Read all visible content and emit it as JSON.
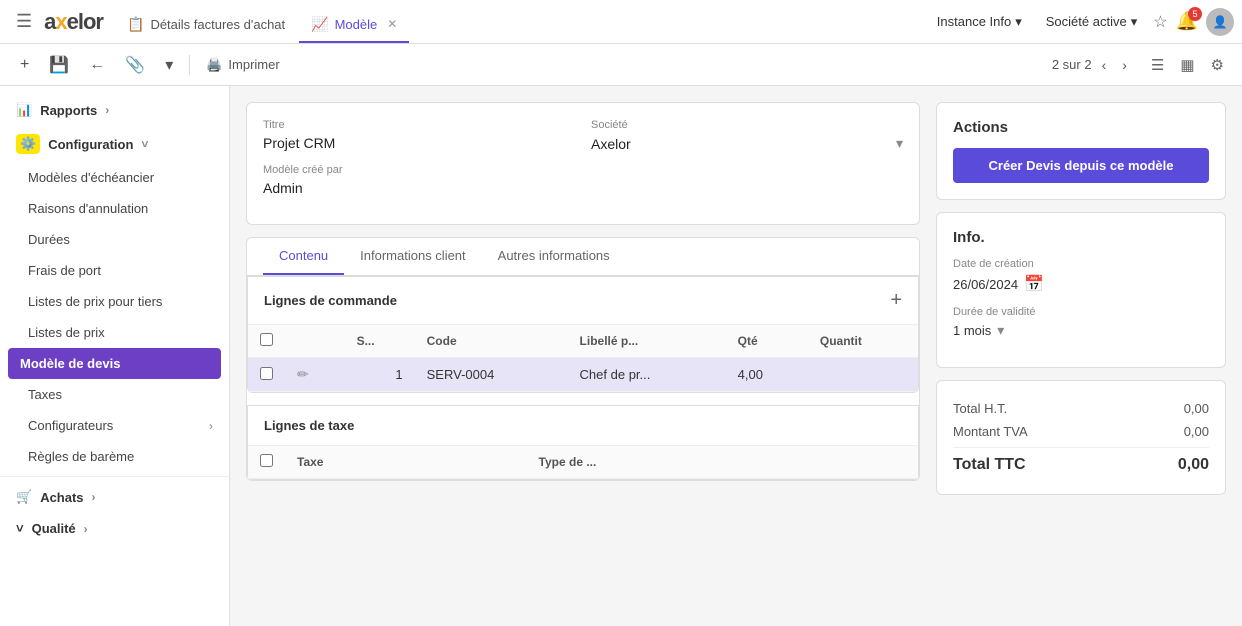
{
  "topbar": {
    "brand": "axelor",
    "tabs": [
      {
        "id": "factures",
        "label": "Détails factures d'achat",
        "icon": "📋",
        "active": false,
        "closable": false
      },
      {
        "id": "modele",
        "label": "Modèle",
        "icon": "📈",
        "active": true,
        "closable": true
      }
    ],
    "instance_info": "Instance Info",
    "societe_active": "Société active",
    "notification_count": "5"
  },
  "actionbar": {
    "add_icon": "+",
    "save_icon": "💾",
    "back_icon": "←",
    "attach_icon": "📎",
    "arrow_icon": "▾",
    "print_label": "Imprimer",
    "pagination": "2 sur 2"
  },
  "sidebar": {
    "sections": [
      {
        "id": "rapports",
        "label": "Rapports",
        "icon": "📊",
        "has_children": true
      },
      {
        "id": "configuration",
        "label": "Configuration",
        "icon": "⚙️",
        "has_children": true,
        "expanded": true
      }
    ],
    "config_items": [
      {
        "id": "modeles-echeancier",
        "label": "Modèles d'échéancier"
      },
      {
        "id": "raisons-annulation",
        "label": "Raisons d'annulation"
      },
      {
        "id": "durees",
        "label": "Durées"
      },
      {
        "id": "frais-port",
        "label": "Frais de port"
      },
      {
        "id": "listes-prix-tiers",
        "label": "Listes de prix pour tiers"
      },
      {
        "id": "listes-prix",
        "label": "Listes de prix"
      },
      {
        "id": "modele-devis",
        "label": "Modèle de devis",
        "active": true
      }
    ],
    "other_sections": [
      {
        "id": "taxes",
        "label": "Taxes"
      },
      {
        "id": "configurateurs",
        "label": "Configurateurs",
        "has_children": true
      },
      {
        "id": "regles-bareme",
        "label": "Règles de barème"
      },
      {
        "id": "achats",
        "label": "Achats",
        "icon": "🛒",
        "has_children": true
      },
      {
        "id": "qualite",
        "label": "Qualité",
        "has_children": true
      }
    ]
  },
  "form": {
    "title_label": "Titre",
    "title_value": "Projet CRM",
    "societe_label": "Société",
    "societe_value": "Axelor",
    "modele_cree_par_label": "Modèle créé par",
    "modele_cree_par_value": "Admin",
    "tabs": [
      {
        "id": "contenu",
        "label": "Contenu",
        "active": true
      },
      {
        "id": "informations-client",
        "label": "Informations client",
        "active": false
      },
      {
        "id": "autres-informations",
        "label": "Autres informations",
        "active": false
      }
    ],
    "lignes_commande": {
      "title": "Lignes de commande",
      "columns": [
        "",
        "S...",
        "Code",
        "Libellé p...",
        "Qté",
        "Quantit"
      ],
      "rows": [
        {
          "seq": "1",
          "code": "SERV-0004",
          "libelle": "Chef de pr...",
          "qte": "4,00",
          "quantit": ""
        }
      ]
    },
    "lignes_taxe": {
      "title": "Lignes de taxe",
      "columns": [
        "Taxe",
        "Type de ..."
      ]
    }
  },
  "right_panel": {
    "actions_title": "Actions",
    "create_btn_label": "Créer Devis depuis ce modèle",
    "info_title": "Info.",
    "date_creation_label": "Date de création",
    "date_creation_value": "26/06/2024",
    "duree_validite_label": "Durée de validité",
    "duree_validite_value": "1 mois",
    "totals": {
      "ht_label": "Total H.T.",
      "ht_value": "0,00",
      "tva_label": "Montant TVA",
      "tva_value": "0,00",
      "ttc_label": "Total TTC",
      "ttc_value": "0,00"
    }
  }
}
